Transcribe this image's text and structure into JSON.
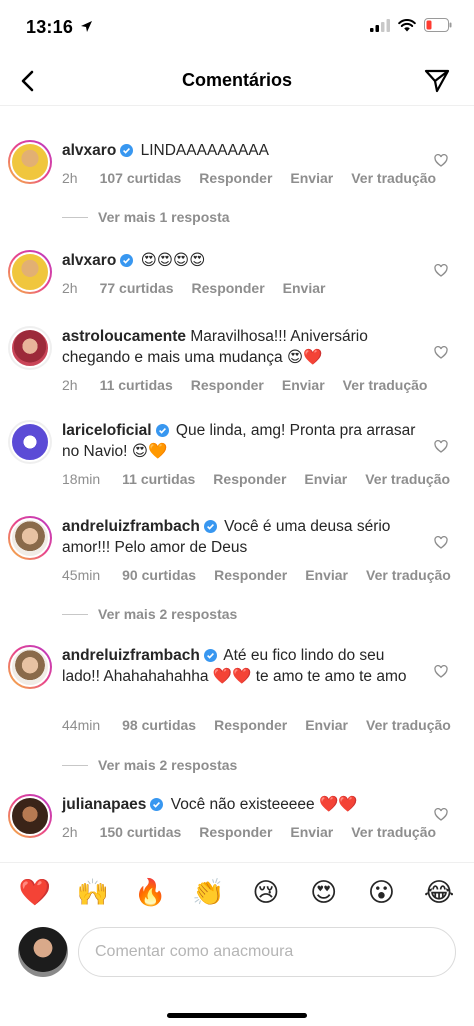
{
  "status_bar": {
    "time": "13:16"
  },
  "header": {
    "title": "Comentários"
  },
  "comments": [
    {
      "username": "alvxaro",
      "verified": true,
      "text": "LINDAAAAAAAAA",
      "time": "2h",
      "likes": "107 curtidas",
      "reply": "Responder",
      "send": "Enviar",
      "translate": "Ver tradução",
      "more_replies": "Ver mais 1 resposta"
    },
    {
      "username": "alvxaro",
      "verified": true,
      "text": "😍😍😍😍",
      "time": "2h",
      "likes": "77 curtidas",
      "reply": "Responder",
      "send": "Enviar"
    },
    {
      "username": "astroloucamente",
      "verified": false,
      "text": "Maravilhosa!!! Aniversário chegando e mais uma mudança 😍❤️",
      "time": "2h",
      "likes": "11 curtidas",
      "reply": "Responder",
      "send": "Enviar",
      "translate": "Ver tradução"
    },
    {
      "username": "lariceloficial",
      "verified": true,
      "text": "Que linda, amg! Pronta pra arrasar no Navio! 😍🧡",
      "time": "18min",
      "likes": "11 curtidas",
      "reply": "Responder",
      "send": "Enviar",
      "translate": "Ver tradução"
    },
    {
      "username": "andreluizframbach",
      "verified": true,
      "text": "Você é uma deusa sério amor!!! Pelo amor de Deus",
      "time": "45min",
      "likes": "90 curtidas",
      "reply": "Responder",
      "send": "Enviar",
      "translate": "Ver tradução",
      "more_replies": "Ver mais 2 respostas"
    },
    {
      "username": "andreluizframbach",
      "verified": true,
      "text": "Até eu fico lindo do seu lado!! Ahahahahahha ❤️❤️ te amo te amo te amo",
      "time": "44min",
      "likes": "98 curtidas",
      "reply": "Responder",
      "send": "Enviar",
      "translate": "Ver tradução",
      "more_replies": "Ver mais 2 respostas"
    },
    {
      "username": "julianapaes",
      "verified": true,
      "text": "Você não existeeeee ❤️❤️",
      "time": "2h",
      "likes": "150 curtidas",
      "reply": "Responder",
      "send": "Enviar",
      "translate": "Ver tradução"
    }
  ],
  "emoji_bar": [
    "❤️",
    "🙌",
    "🔥",
    "👏",
    "😢",
    "😍",
    "😮",
    "😂"
  ],
  "input": {
    "placeholder": "Comentar como anacmoura"
  },
  "colors": {
    "verified": "#3897f0",
    "meta": "#8e8e8e",
    "text": "#262626"
  }
}
